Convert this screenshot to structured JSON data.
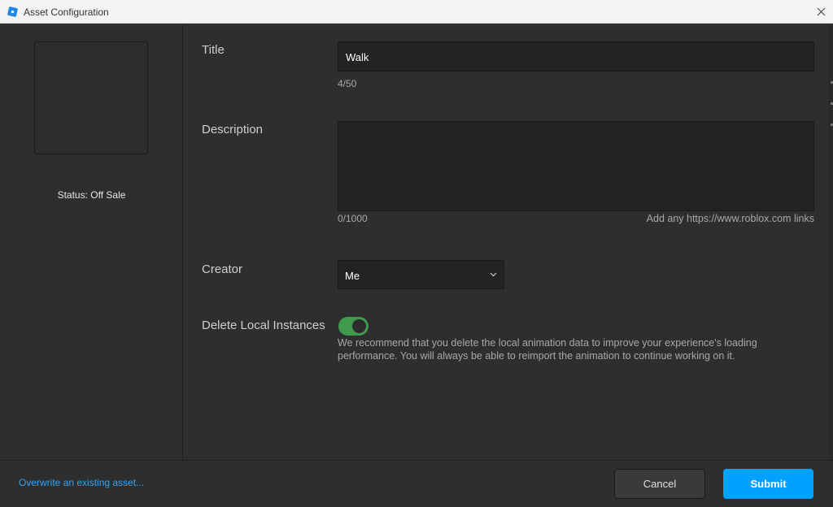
{
  "window": {
    "title": "Asset Configuration",
    "app_icon": "roblox-studio-icon",
    "close_icon": "close-icon"
  },
  "left_panel": {
    "status": "Status: Off Sale"
  },
  "form": {
    "title": {
      "label": "Title",
      "value": "Walk",
      "counter": "4/50"
    },
    "description": {
      "label": "Description",
      "value": "",
      "counter": "0/1000",
      "hint": "Add any https://www.roblox.com links"
    },
    "creator": {
      "label": "Creator",
      "selected": "Me"
    },
    "delete_local": {
      "label": "Delete Local Instances",
      "enabled": true,
      "description": "We recommend that you delete the local animation data to improve your experience's loading performance. You will always be able to reimport the animation to continue working on it."
    }
  },
  "footer": {
    "overwrite_link": "Overwrite an existing asset...",
    "cancel_label": "Cancel",
    "submit_label": "Submit"
  },
  "colors": {
    "accent": "#00a2ff",
    "link": "#35a4f5",
    "toggle_on": "#3e9b4e",
    "background": "#2e2e2e",
    "input_bg": "#232323"
  }
}
